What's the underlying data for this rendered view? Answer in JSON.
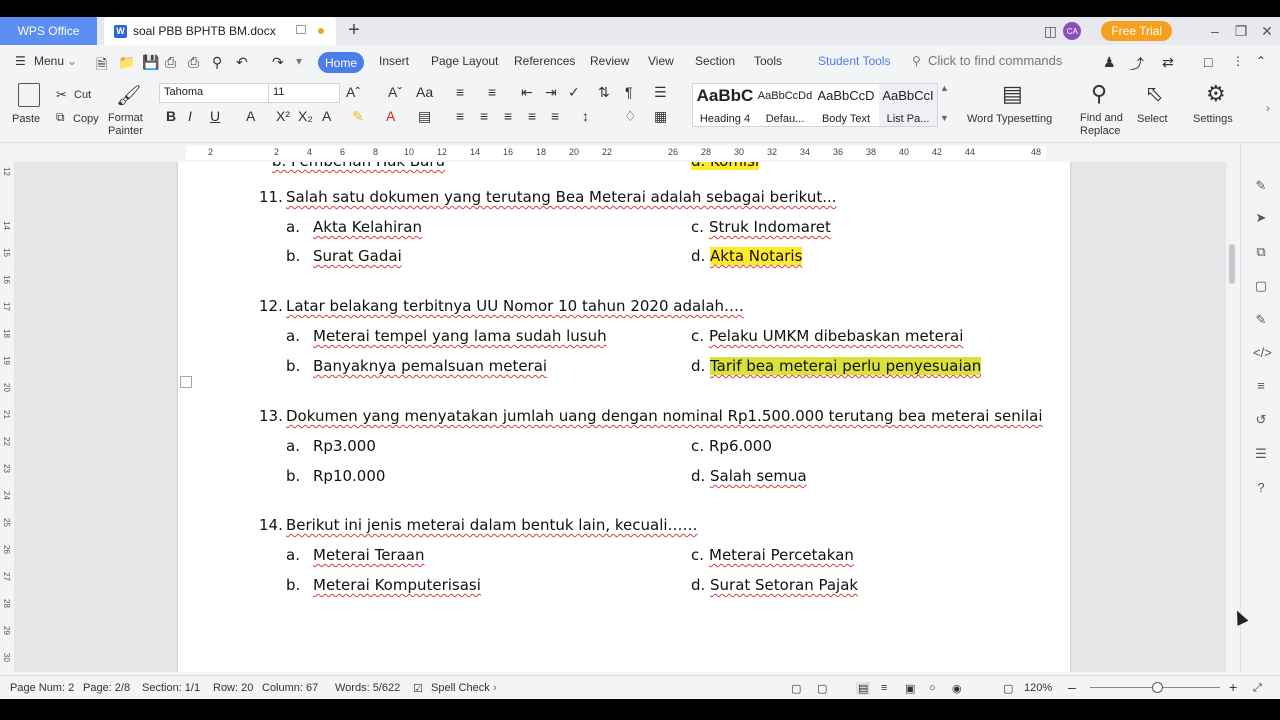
{
  "titlebar": {
    "app_tab": "WPS Office",
    "doc_tab": "soal PBB BPHTB BM.docx",
    "avatar": "CA",
    "free_trial": "Free Trial"
  },
  "menubar": {
    "menu": "Menu",
    "tabs": [
      "Home",
      "Insert",
      "Page Layout",
      "References",
      "Review",
      "View",
      "Section",
      "Tools"
    ],
    "student_tools": "Student Tools",
    "search_placeholder": "Click to find commands"
  },
  "ribbon": {
    "paste": "Paste",
    "cut": "Cut",
    "copy": "Copy",
    "format_painter_1": "Format",
    "format_painter_2": "Painter",
    "font_name": "Tahoma",
    "font_size": "11",
    "styles": [
      {
        "preview": "AaBbC",
        "name": "Heading 4"
      },
      {
        "preview": "AaBbCcDd",
        "name": "Defau..."
      },
      {
        "preview": "AaBbCcD",
        "name": "Body Text"
      },
      {
        "preview": "AaBbCcI",
        "name": "List Pa..."
      }
    ],
    "word_typesetting": "Word Typesetting",
    "find_replace_1": "Find and",
    "find_replace_2": "Replace",
    "select": "Select",
    "settings": "Settings"
  },
  "ruler": {
    "ticks": [
      "2",
      "2",
      "4",
      "6",
      "8",
      "10",
      "12",
      "14",
      "16",
      "18",
      "20",
      "22",
      "26",
      "28",
      "30",
      "32",
      "34",
      "36",
      "38",
      "40",
      "42",
      "44",
      "48"
    ],
    "vticks": [
      "12",
      "14",
      "15",
      "16",
      "17",
      "18",
      "19",
      "20",
      "21",
      "22",
      "23",
      "24",
      "25",
      "26",
      "27",
      "28",
      "29",
      "30"
    ]
  },
  "document": {
    "prev_b": "b.   Pemberian Hak Baru",
    "prev_d": "d.  Komisi",
    "questions": [
      {
        "number": "11.",
        "text": "Salah satu dokumen yang terutang Bea Meterai adalah sebagai berikut...",
        "a": "Akta Kelahiran",
        "b": "Surat Gadai",
        "c": "Struk Indomaret",
        "d": "Akta Notaris"
      },
      {
        "number": "12.",
        "text": "Latar belakang terbitnya UU Nomor 10 tahun 2020 adalah….",
        "a": "Meterai tempel yang lama sudah lusuh",
        "b": "Banyaknya pemalsuan meterai",
        "c": "Pelaku UMKM dibebaskan meterai",
        "d": "Tarif bea meterai perlu penyesuaian"
      },
      {
        "number": "13.",
        "text": "Dokumen yang menyatakan jumlah uang dengan nominal Rp1.500.000 terutang bea meterai senilai",
        "a": "Rp3.000",
        "b": "Rp10.000",
        "c": "Rp6.000",
        "d": "Salah semua"
      },
      {
        "number": "14.",
        "text": "Berikut ini jenis meterai dalam bentuk lain, kecuali……",
        "a": "Meterai Teraan",
        "b": "Meterai Komputerisasi",
        "c": "Meterai Percetakan",
        "d": "Surat Setoran Pajak"
      }
    ],
    "labels": {
      "a": "a.",
      "b": "b.",
      "c": "c.",
      "d": "d."
    }
  },
  "statusbar": {
    "page_num": "Page Num: 2",
    "page": "Page: 2/8",
    "section": "Section: 1/1",
    "row": "Row: 20",
    "column": "Column: 67",
    "words": "Words: 5/622",
    "spell_check": "Spell Check",
    "zoom": "120%"
  },
  "colors": {
    "accent": "#4a7de8",
    "highlight_yellow": "#ffeb2a",
    "free_trial": "#f7a020"
  }
}
